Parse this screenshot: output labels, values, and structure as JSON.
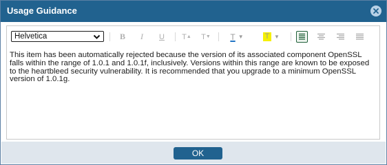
{
  "dialog": {
    "title": "Usage Guidance",
    "close_icon": "close-circle-icon"
  },
  "toolbar": {
    "font_family": "Helvetica",
    "bold_label": "B",
    "italic_label": "I",
    "underline_label": "U",
    "superscript_label": "T",
    "subscript_label": "T",
    "text_color_label": "T",
    "highlight_label": "T",
    "text_color_accent": "#1f73c4",
    "highlight_color": "#f5f000",
    "alignment_selected": "left"
  },
  "content": {
    "text": "This item has been automatically rejected because the version of its associated component OpenSSL falls within the range of 1.0.1 and 1.0.1f, inclusively. Versions within this range are known to be exposed to the heartbleed security vulnerability. It is recommended that you upgrade to a minimum OpenSSL version of 1.0.1g."
  },
  "footer": {
    "ok_label": "OK"
  }
}
